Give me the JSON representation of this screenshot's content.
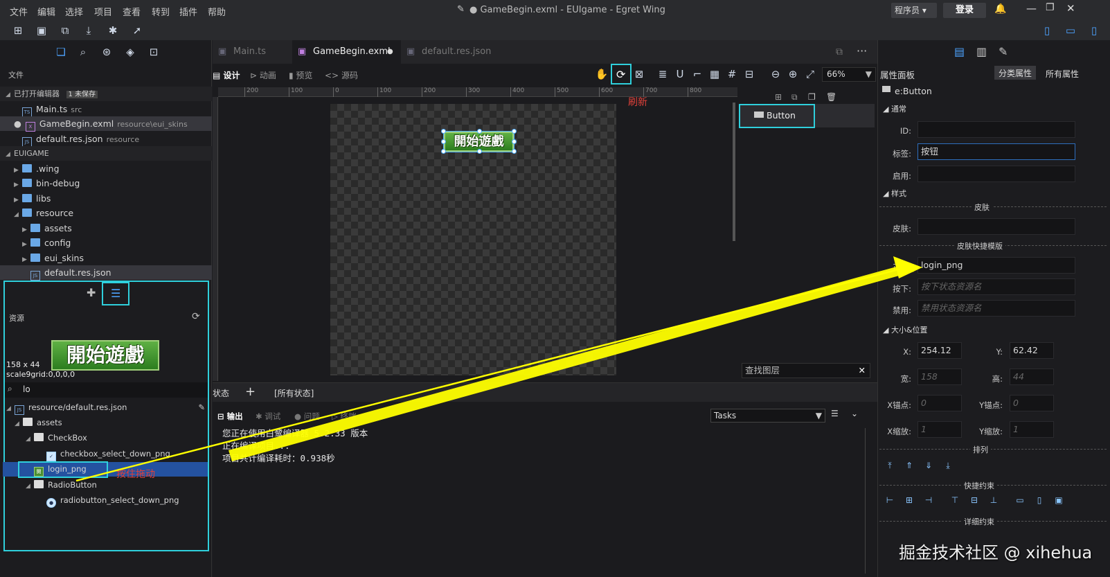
{
  "menu": [
    "文件",
    "编辑",
    "选择",
    "项目",
    "查看",
    "转到",
    "插件",
    "帮助"
  ],
  "window_title": "● GameBegin.exml - EUIgame - Egret Wing",
  "user": {
    "role": "程序员",
    "login": "登录"
  },
  "explorer": {
    "header": "文件",
    "open_editors_label": "已打开编辑器",
    "unsaved_badge": "1 未保存",
    "open_files": [
      {
        "name": "Main.ts",
        "path": "src"
      },
      {
        "name": "GameBegin.exml",
        "path": "resource\\eui_skins"
      },
      {
        "name": "default.res.json",
        "path": "resource"
      }
    ],
    "project": "EUIGAME",
    "tree": [
      ".wing",
      "bin-debug",
      "libs",
      "resource",
      "assets",
      "config",
      "eui_skins",
      "default.res.json"
    ]
  },
  "resources": {
    "label": "资源",
    "preview_size": "158 x 44",
    "preview_scale9": "scale9grid:0,0,0,0",
    "preview_text": "開始遊戲",
    "search": "lo",
    "tree": [
      "resource/default.res.json",
      "assets",
      "CheckBox",
      "checkbox_select_down_png",
      "login_png",
      "RadioButton",
      "radiobutton_select_down_png"
    ],
    "drag_note": "按住拖动"
  },
  "editor": {
    "tabs": [
      "Main.ts",
      "GameBegin.exml",
      "default.res.json"
    ],
    "modes": [
      "设计",
      "动画",
      "预览",
      "源码"
    ],
    "zoom": "66%",
    "refresh_note": "刷新",
    "ruler": [
      "200",
      "100",
      "0",
      "100",
      "200",
      "300",
      "400",
      "500",
      "600",
      "700",
      "800"
    ],
    "canvas_button_text": "開始遊戲",
    "layer_item": "Button",
    "layer_search_placeholder": "查找图层",
    "state_label": "状态",
    "state_all": "[所有状态]"
  },
  "output": {
    "tabs": [
      "输出",
      "调试",
      "问题",
      "终端"
    ],
    "channel": "Tasks",
    "lines": [
      "您正在使用白鹭编译器 5.2.33 版本",
      "正在编译项目...",
      "项目共计编译耗时：0.938秒"
    ]
  },
  "properties": {
    "title": "属性面板",
    "tab_category": "分类属性",
    "tab_all": "所有属性",
    "component": "e:Button",
    "section_general": "通常",
    "id_label": "ID:",
    "label_label": "标签:",
    "label_value": "按钮",
    "enabled_label": "启用:",
    "section_style": "样式",
    "skin_divider": "皮肤",
    "skin_label": "皮肤:",
    "skin_quick": "皮肤快捷模版",
    "normal_label": "正常:",
    "normal_value": "login_png",
    "down_label": "按下:",
    "down_placeholder": "按下状态资源名",
    "disabled_label": "禁用:",
    "disabled_placeholder": "禁用状态资源名",
    "section_size": "大小&位置",
    "x_label": "X:",
    "x_value": "254.12",
    "y_label": "Y:",
    "y_value": "62.42",
    "w_label": "宽:",
    "w_value": "158",
    "h_label": "高:",
    "h_value": "44",
    "ax_label": "X锚点:",
    "ax_value": "0",
    "ay_label": "Y锚点:",
    "ay_value": "0",
    "sx_label": "X缩放:",
    "sx_value": "1",
    "sy_label": "Y缩放:",
    "sy_value": "1",
    "arrange": "排列",
    "quick_constraint": "快捷约束",
    "detail_constraint": "详细约束"
  },
  "watermark": "掘金技术社区 @ xihehua",
  "colors": {
    "highlight": "#2fd0dc",
    "arrow": "#ffff00",
    "annotation": "#e0413a",
    "selection": "#2452a0"
  }
}
